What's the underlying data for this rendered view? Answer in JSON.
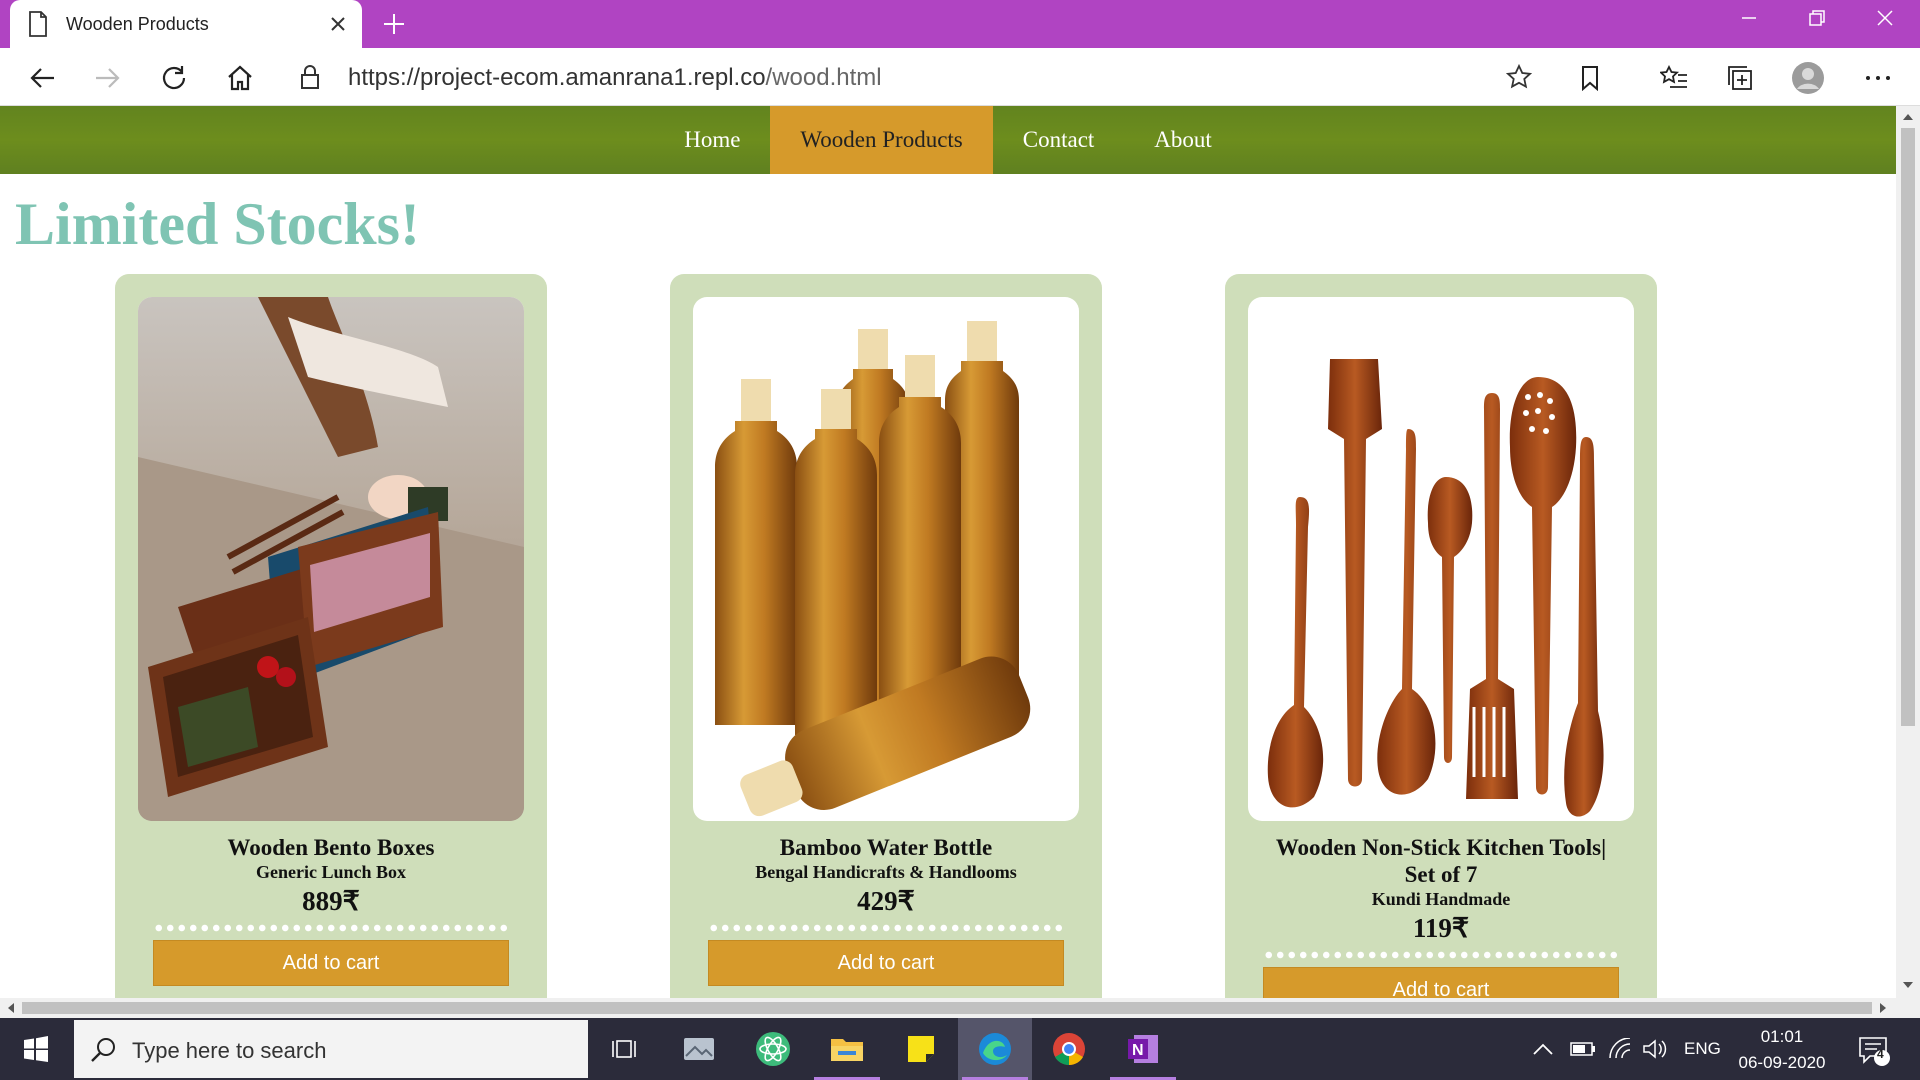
{
  "browser": {
    "tab_title": "Wooden Products",
    "url_main": "https://project-ecom.amanrana1.repl.co",
    "url_path": "/wood.html"
  },
  "nav": {
    "items": [
      {
        "label": "Home",
        "active": false
      },
      {
        "label": "Wooden Products",
        "active": true
      },
      {
        "label": "Contact",
        "active": false
      },
      {
        "label": "About",
        "active": false
      }
    ]
  },
  "page": {
    "headline": "Limited Stocks!"
  },
  "products": [
    {
      "name": "Wooden Bento Boxes",
      "brand": "Generic Lunch Box",
      "price": "889₹",
      "cart_label": "Add to cart"
    },
    {
      "name": "Bamboo Water Bottle",
      "brand": "Bengal Handicrafts & Handlooms",
      "price": "429₹",
      "cart_label": "Add to cart"
    },
    {
      "name_line1": "Wooden Non-Stick Kitchen Tools|",
      "name_line2": "Set of 7",
      "brand": "Kundi Handmade",
      "price": "119₹",
      "cart_label": "Add to cart"
    }
  ],
  "taskbar": {
    "search_placeholder": "Type here to search",
    "language": "ENG",
    "time": "01:01",
    "date": "06-09-2020",
    "notification_count": "4"
  },
  "colors": {
    "titlebar": "#b044c2",
    "nav_green": "#6d8d1d",
    "accent_orange": "#d69a2b",
    "card_bg": "#cfdeba",
    "headline": "#7fc4b3"
  }
}
